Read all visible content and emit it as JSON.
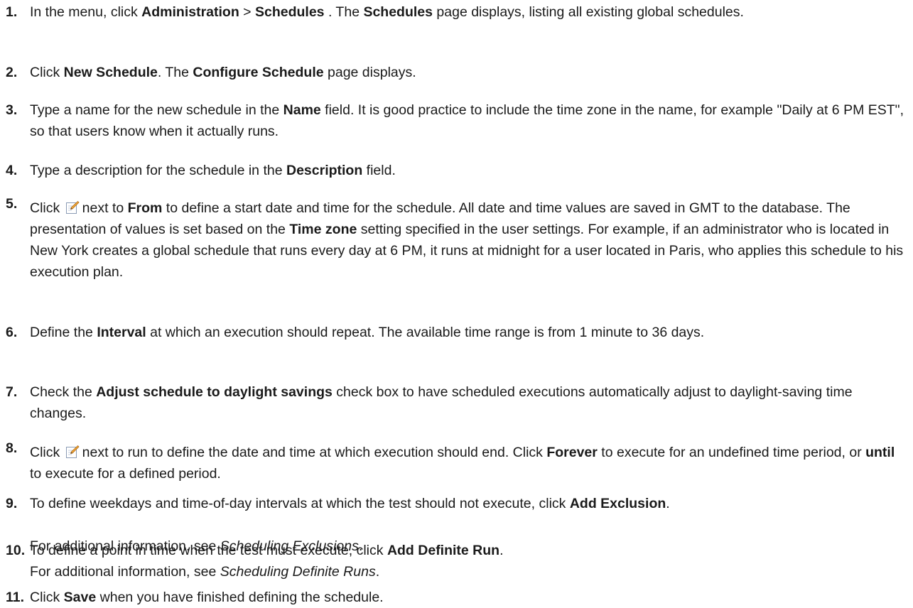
{
  "steps": [
    {
      "num": "1.",
      "parts": [
        [
          "t",
          "In the menu, click "
        ],
        [
          "b",
          "Administration"
        ],
        [
          "t",
          " > "
        ],
        [
          "b",
          "Schedules"
        ],
        [
          "t",
          " . The "
        ],
        [
          "b",
          "Schedules"
        ],
        [
          "t",
          " page displays, listing all existing global schedules."
        ]
      ]
    },
    {
      "num": "2.",
      "parts": [
        [
          "t",
          "Click "
        ],
        [
          "b",
          "New Schedule"
        ],
        [
          "t",
          ". The "
        ],
        [
          "b",
          "Configure Schedule"
        ],
        [
          "t",
          " page displays."
        ]
      ]
    },
    {
      "num": "3.",
      "parts": [
        [
          "t",
          "Type a name for the new schedule in the "
        ],
        [
          "b",
          "Name"
        ],
        [
          "t",
          " field. It is good practice to include the time zone in the name, for example \"Daily at 6 PM EST\", so that users know when it actually runs."
        ]
      ]
    },
    {
      "num": "4.",
      "parts": [
        [
          "t",
          "Type a description for the schedule in the "
        ],
        [
          "b",
          "Description"
        ],
        [
          "t",
          " field."
        ]
      ]
    },
    {
      "num": "5.",
      "parts": [
        [
          "t",
          "Click "
        ],
        [
          "icon",
          "edit-icon"
        ],
        [
          "t",
          "next to "
        ],
        [
          "b",
          "From"
        ],
        [
          "t",
          " to define a start date and time for the schedule. All date and time values are saved in GMT to the database. The presentation of values is set based on the "
        ],
        [
          "b",
          "Time zone"
        ],
        [
          "t",
          " setting specified in the user settings. For example, if an administrator who is located in New York creates a global schedule that runs every day at 6 PM, it runs at midnight for a user located in Paris, who applies this schedule to his execution plan."
        ]
      ]
    },
    {
      "num": "6.",
      "parts": [
        [
          "t",
          "Define the "
        ],
        [
          "b",
          "Interval"
        ],
        [
          "t",
          " at which an execution should repeat. The available time range is from 1 minute to 36 days."
        ]
      ]
    },
    {
      "num": "7.",
      "parts": [
        [
          "t",
          "Check the "
        ],
        [
          "b",
          "Adjust schedule to daylight savings"
        ],
        [
          "t",
          " check box to have scheduled executions automatically adjust to daylight-saving time changes."
        ]
      ]
    },
    {
      "num": "8.",
      "parts": [
        [
          "t",
          "Click "
        ],
        [
          "icon",
          "edit-icon"
        ],
        [
          "t",
          "next to run to define the date and time at which execution should end. Click "
        ],
        [
          "b",
          "Forever"
        ],
        [
          "t",
          " to execute for an undefined time period, or "
        ],
        [
          "b",
          "until"
        ],
        [
          "t",
          " to execute for a defined period."
        ]
      ]
    },
    {
      "num": "9.",
      "parts": [
        [
          "t",
          "To define weekdays and time-of-day intervals at which the test should not execute, click "
        ],
        [
          "b",
          "Add Exclusion"
        ],
        [
          "t",
          "."
        ]
      ],
      "note": [
        [
          "t",
          "For additional information, see "
        ],
        [
          "i",
          "Scheduling Exclusions"
        ],
        [
          "t",
          "."
        ]
      ]
    },
    {
      "num": "10.",
      "parts": [
        [
          "t",
          "To define a point in time when the test must execute, click "
        ],
        [
          "b",
          "Add Definite Run"
        ],
        [
          "t",
          "."
        ]
      ],
      "note": [
        [
          "t",
          "For additional information, see "
        ],
        [
          "i",
          "Scheduling Definite Runs"
        ],
        [
          "t",
          "."
        ]
      ]
    },
    {
      "num": "11.",
      "parts": [
        [
          "t",
          "Click "
        ],
        [
          "b",
          "Save"
        ],
        [
          "t",
          " when you have finished defining the schedule."
        ]
      ]
    }
  ]
}
